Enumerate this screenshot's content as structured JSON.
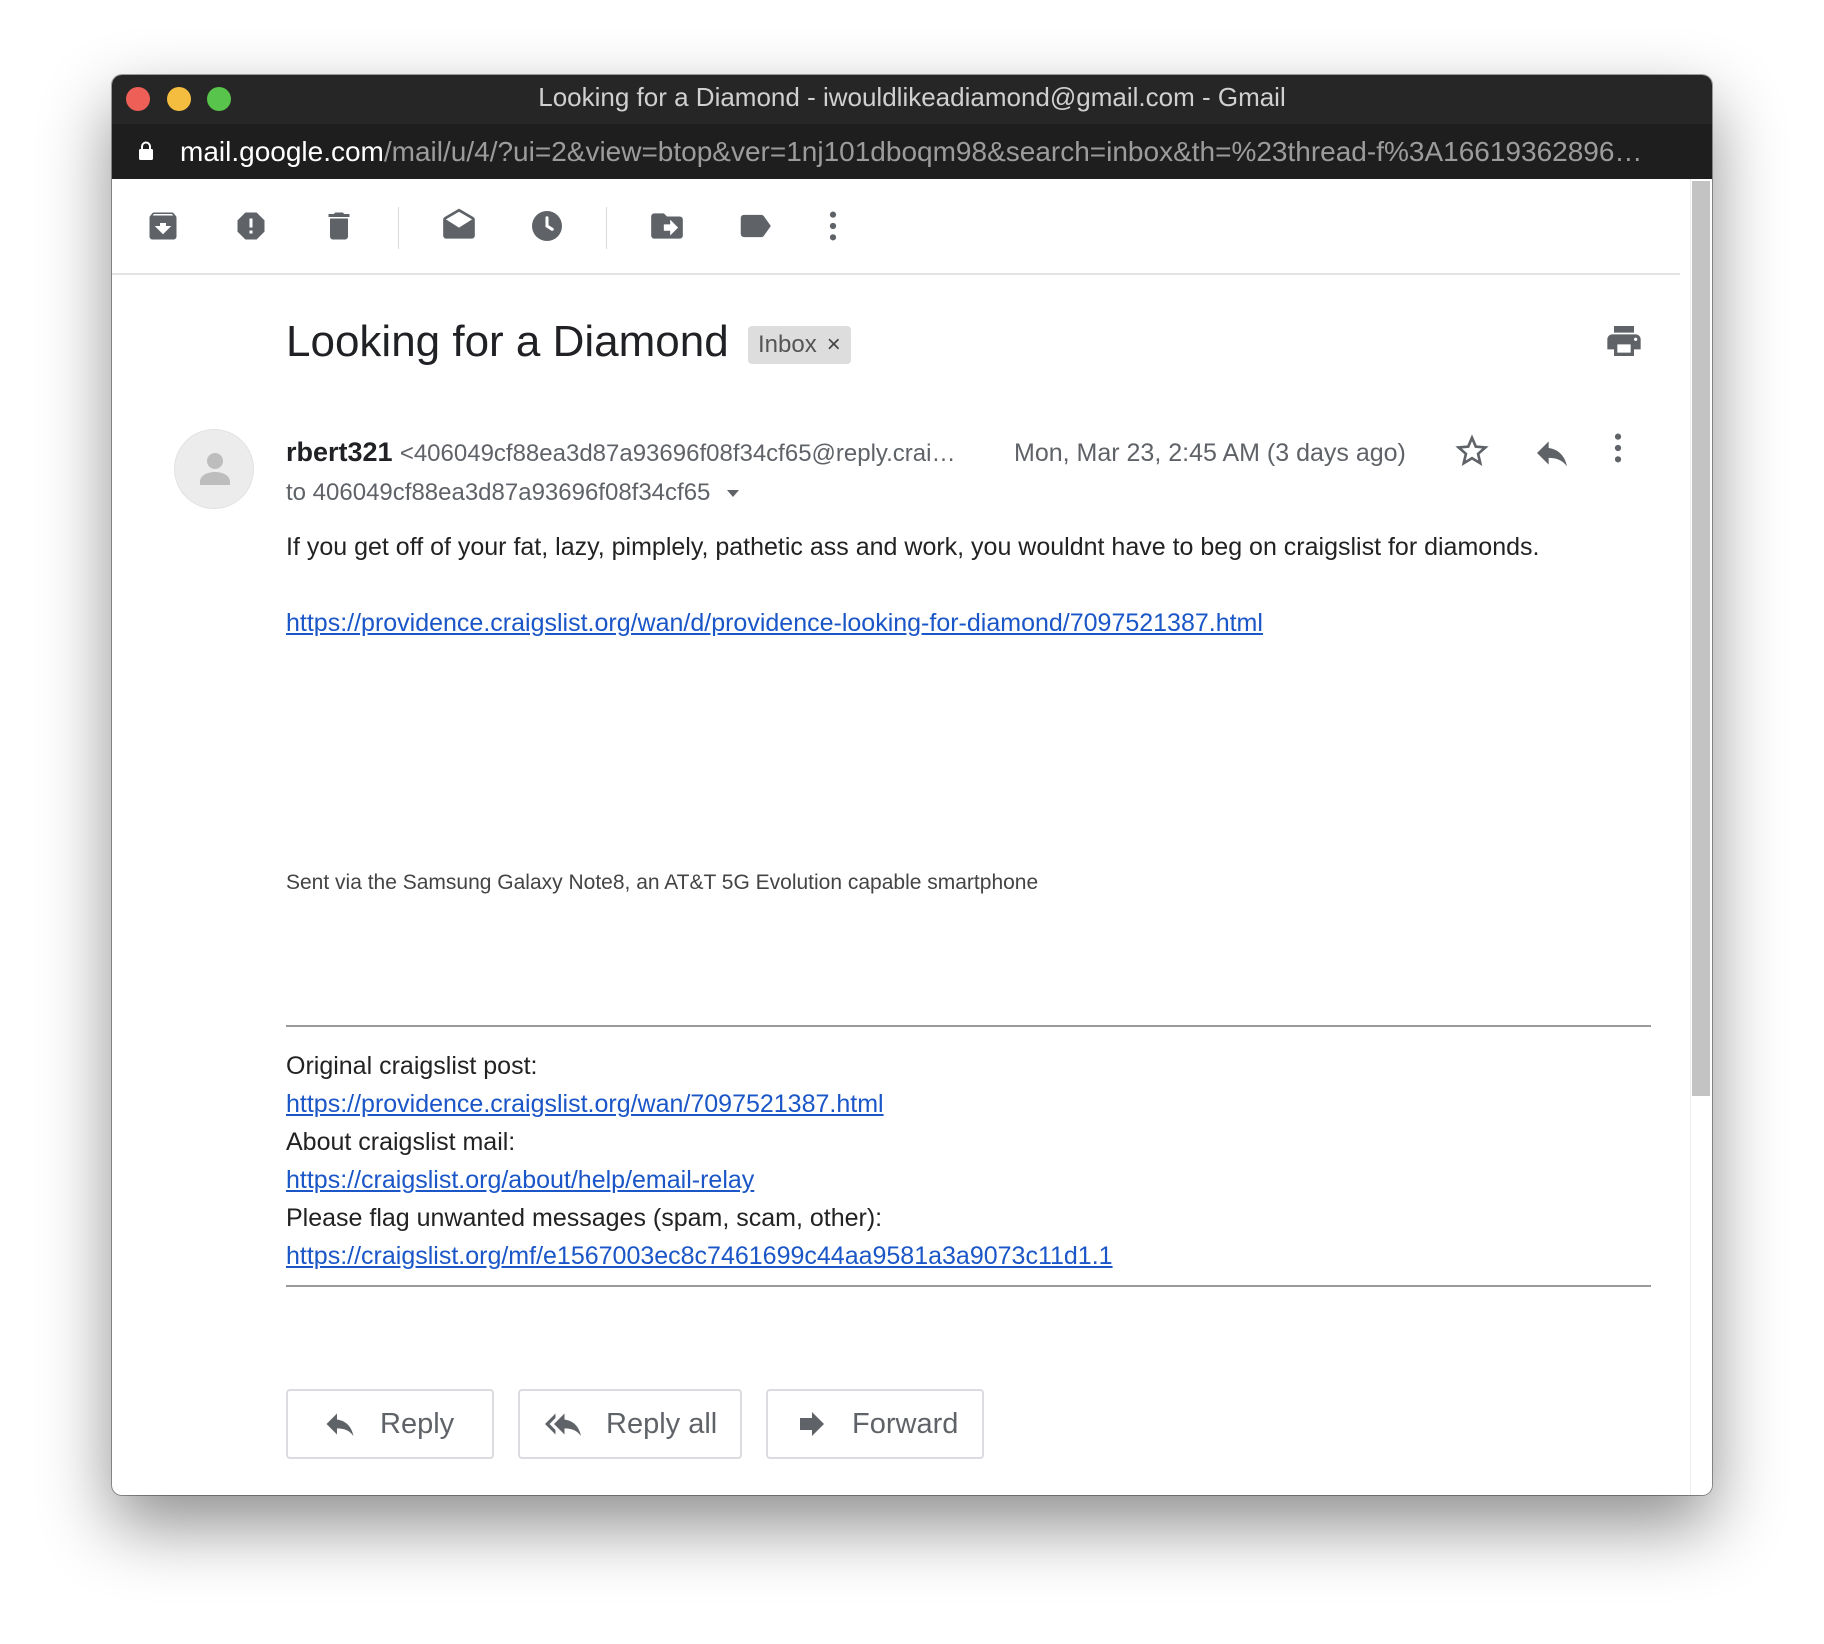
{
  "window": {
    "title": "Looking for a Diamond - iwouldlikeadiamond@gmail.com - Gmail",
    "url_domain": "mail.google.com",
    "url_path": "/mail/u/4/?ui=2&view=btop&ver=1nj101dboqm98&search=inbox&th=%23thread-f%3A16619362896…"
  },
  "toolbar": {
    "icons": [
      "archive-icon",
      "report-spam-icon",
      "delete-icon",
      "mark-unread-icon",
      "snooze-icon",
      "move-to-icon",
      "label-icon",
      "more-vert-icon"
    ]
  },
  "email": {
    "subject": "Looking for a Diamond",
    "label": "Inbox",
    "label_remove": "×",
    "sender_name": "rbert321",
    "sender_email": "<406049cf88ea3d87a93696f08f34cf65@reply.crai…",
    "date": "Mon, Mar 23, 2:45 AM (3 days ago)",
    "to": "to 406049cf88ea3d87a93696f08f34cf65",
    "body": "If you get off of your fat, lazy, pimplely, pathetic ass and work, you wouldnt have to beg on craigslist for diamonds.",
    "link": "https://providence.craigslist.org/wan/d/providence-looking-for-diamond/7097521387.html",
    "signature": "Sent via the Samsung Galaxy Note8, an AT&T 5G Evolution capable smartphone",
    "footer": {
      "original_label": "Original craigslist post:",
      "original_link": "https://providence.craigslist.org/wan/7097521387.html",
      "about_label": "About craigslist mail:",
      "about_link": "https://craigslist.org/about/help/email-relay",
      "flag_label": "Please flag unwanted messages (spam, scam, other):",
      "flag_link": "https://craigslist.org/mf/e1567003ec8c7461699c44aa9581a3a9073c11d1.1"
    }
  },
  "actions": {
    "reply": "Reply",
    "reply_all": "Reply all",
    "forward": "Forward"
  },
  "colors": {
    "link": "#1a56c7",
    "titlebar": "#262626",
    "icon": "#5f6368"
  }
}
